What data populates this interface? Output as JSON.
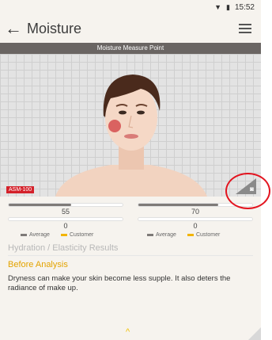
{
  "status": {
    "time": "15:52",
    "wifi_icon": "wifi-icon",
    "battery_icon": "battery-icon"
  },
  "app": {
    "title": "Moisture",
    "back_icon": "arrow-left-icon",
    "menu_icon": "hamburger-menu-icon"
  },
  "measure_bar": {
    "label": "Moisture Measure Point"
  },
  "photo": {
    "badge": "ASM-100",
    "camera_icon": "camera-icon"
  },
  "gauges": [
    {
      "top_value": "55",
      "top_fill": 0.55,
      "bottom_value": "0",
      "bottom_fill": 0.0,
      "legend_average": "Average",
      "legend_customer": "Customer"
    },
    {
      "top_value": "70",
      "top_fill": 0.7,
      "bottom_value": "0",
      "bottom_fill": 0.0,
      "legend_average": "Average",
      "legend_customer": "Customer"
    }
  ],
  "section": {
    "heading": "Hydration / Elasticity Results",
    "subheading": "Before Analysis",
    "description": "Dryness can make your skin become less supple. It also deters the radiance of make up."
  },
  "colors": {
    "accent": "#e3a300",
    "badge": "#d4212a",
    "average": "#7e7a78",
    "customer": "#f2b400",
    "annotation": "#e3141f"
  }
}
